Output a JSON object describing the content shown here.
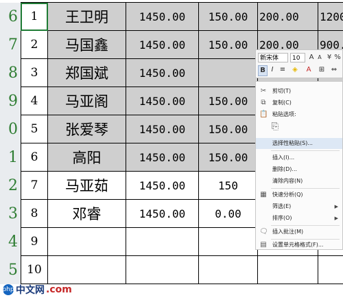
{
  "row_headers": [
    "6",
    "7",
    "8",
    "9",
    "0",
    "1",
    "2",
    "3",
    "4",
    "5"
  ],
  "rows": [
    {
      "n": "1",
      "name": "王卫明",
      "c1": "1450.00",
      "c2": "150.00",
      "c3": "200.00",
      "c4": "1200"
    },
    {
      "n": "2",
      "name": "马国鑫",
      "c1": "1450.00",
      "c2": "150.00",
      "c3": "200.00",
      "c4": "900."
    },
    {
      "n": "3",
      "name": "郑国斌",
      "c1": "1450.00",
      "c2": "",
      "c3": "",
      "c4": ""
    },
    {
      "n": "4",
      "name": "马亚阁",
      "c1": "1450.00",
      "c2": "150.00",
      "c3": "",
      "c4": ""
    },
    {
      "n": "5",
      "name": "张爱琴",
      "c1": "1450.00",
      "c2": "150.00",
      "c3": "",
      "c4": ""
    },
    {
      "n": "6",
      "name": "高阳",
      "c1": "1450.00",
      "c2": "150.00",
      "c3": "",
      "c4": ""
    },
    {
      "n": "7",
      "name": "马亚茹",
      "c1": "1450.00",
      "c2": "150",
      "c3": "",
      "c4": ""
    },
    {
      "n": "8",
      "name": "邓睿",
      "c1": "1450.00",
      "c2": "0.00",
      "c3": "",
      "c4": ""
    },
    {
      "n": "9",
      "name": "",
      "c1": "",
      "c2": "",
      "c3": "",
      "c4": ""
    },
    {
      "n": "10",
      "name": "",
      "c1": "",
      "c2": "",
      "c3": "",
      "c4": ""
    }
  ],
  "mini_toolbar": {
    "font_name": "新宋体",
    "font_size": "10",
    "bold": "B",
    "italic": "I"
  },
  "context_menu": {
    "cut": "剪切(T)",
    "copy": "复制(C)",
    "paste_options": "粘贴选项:",
    "paste_special": "选择性粘贴(S)...",
    "insert": "插入(I)...",
    "delete": "删除(D)...",
    "clear": "清除内容(N)",
    "quick_analysis": "快速分析(Q)",
    "filter": "筛选(E)",
    "sort": "排序(O)",
    "insert_comment": "插入批注(M)",
    "format_cells": "设置单元格格式(F)..."
  },
  "watermark": {
    "logo": "php",
    "text": "中文网"
  },
  "colors": {
    "grey_fill": "#cfcfcf",
    "row_header_text": "#2e7d32",
    "highlight": "#dde8f5"
  }
}
